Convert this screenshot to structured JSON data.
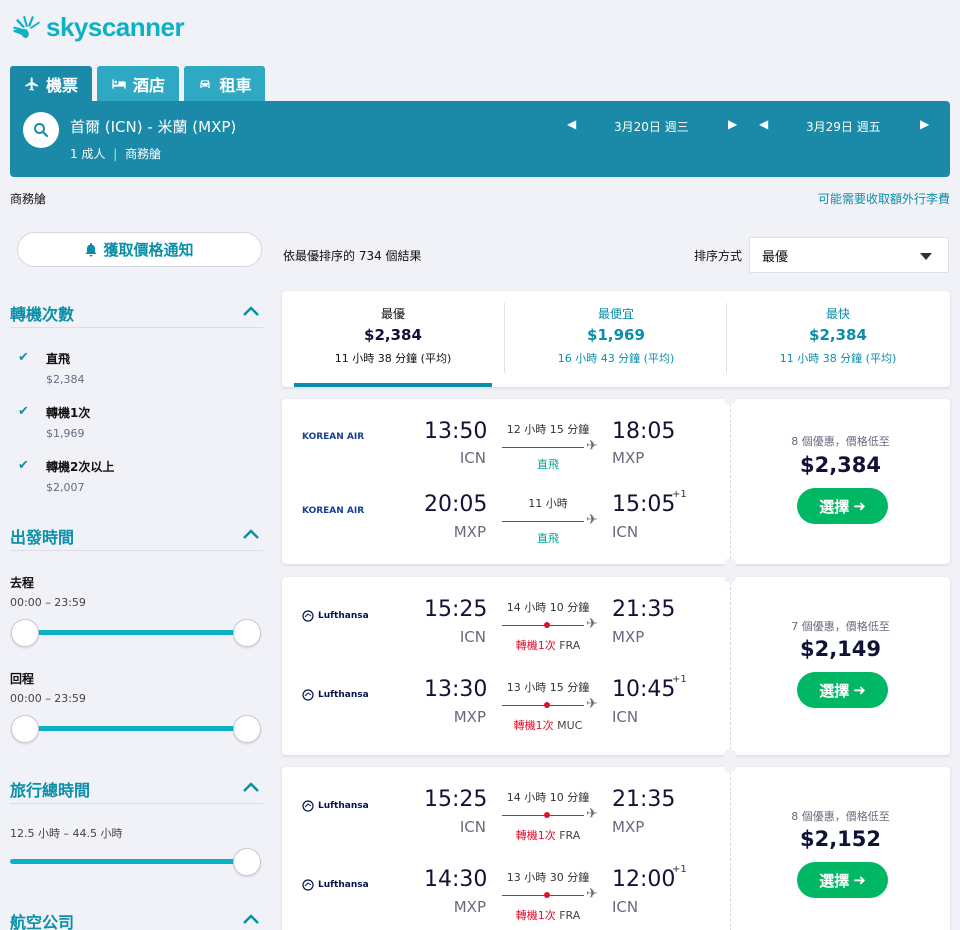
{
  "brand": {
    "name": "skyscanner",
    "color": "#0cb1c6"
  },
  "tabs": [
    {
      "label": "機票",
      "icon": "plane-icon",
      "active": true
    },
    {
      "label": "酒店",
      "icon": "bed-icon",
      "active": false
    },
    {
      "label": "租車",
      "icon": "car-icon",
      "active": false
    }
  ],
  "search": {
    "route": "首爾 (ICN) - 米蘭 (MXP)",
    "passengers": "1 成人",
    "cabin": "商務艙",
    "depart_date": "3月20日 週三",
    "return_date": "3月29日 週五"
  },
  "info_bar": {
    "cabin": "商務艙",
    "bag_notice": "可能需要收取額外行李費"
  },
  "sidebar": {
    "price_alert": "獲取價格通知",
    "stops": {
      "title": "轉機次數",
      "options": [
        {
          "label": "直飛",
          "price": "$2,384",
          "checked": true
        },
        {
          "label": "轉機1次",
          "price": "$1,969",
          "checked": true
        },
        {
          "label": "轉機2次以上",
          "price": "$2,007",
          "checked": true
        }
      ]
    },
    "departure_times": {
      "title": "出發時間",
      "outbound_label": "去程",
      "outbound_range": "00:00 – 23:59",
      "return_label": "回程",
      "return_range": "00:00 – 23:59"
    },
    "duration": {
      "title": "旅行總時間",
      "range": "12.5 小時 – 44.5 小時"
    },
    "airlines": {
      "title": "航空公司"
    }
  },
  "results": {
    "count_text": "依最優排序的 734 個結果",
    "sort_label": "排序方式",
    "sort_value": "最優"
  },
  "sort_tabs": [
    {
      "title": "最優",
      "price": "$2,384",
      "duration": "11 小時 38 分鐘 (平均)",
      "active": true
    },
    {
      "title": "最便宜",
      "price": "$1,969",
      "duration": "16 小時 43 分鐘 (平均)",
      "active": false
    },
    {
      "title": "最快",
      "price": "$2,384",
      "duration": "11 小時 38 分鐘 (平均)",
      "active": false
    }
  ],
  "flights": [
    {
      "legs": [
        {
          "airline": "KOREAN AIR",
          "dep_time": "13:50",
          "dep_code": "ICN",
          "duration": "12 小時 15 分鐘",
          "arr_time": "18:05",
          "arr_code": "MXP",
          "stops": "直飛",
          "via": "",
          "plus": ""
        },
        {
          "airline": "KOREAN AIR",
          "dep_time": "20:05",
          "dep_code": "MXP",
          "duration": "11 小時",
          "arr_time": "15:05",
          "arr_code": "ICN",
          "stops": "直飛",
          "via": "",
          "plus": "+1"
        }
      ],
      "offers": "8 個優惠，價格低至",
      "price": "$2,384",
      "select_label": "選擇"
    },
    {
      "legs": [
        {
          "airline": "Lufthansa",
          "dep_time": "15:25",
          "dep_code": "ICN",
          "duration": "14 小時 10 分鐘",
          "arr_time": "21:35",
          "arr_code": "MXP",
          "stops": "轉機1次",
          "via": "FRA",
          "plus": ""
        },
        {
          "airline": "Lufthansa",
          "dep_time": "13:30",
          "dep_code": "MXP",
          "duration": "13 小時 15 分鐘",
          "arr_time": "10:45",
          "arr_code": "ICN",
          "stops": "轉機1次",
          "via": "MUC",
          "plus": "+1"
        }
      ],
      "offers": "7 個優惠，價格低至",
      "price": "$2,149",
      "select_label": "選擇"
    },
    {
      "legs": [
        {
          "airline": "Lufthansa",
          "dep_time": "15:25",
          "dep_code": "ICN",
          "duration": "14 小時 10 分鐘",
          "arr_time": "21:35",
          "arr_code": "MXP",
          "stops": "轉機1次",
          "via": "FRA",
          "plus": ""
        },
        {
          "airline": "Lufthansa",
          "dep_time": "14:30",
          "dep_code": "MXP",
          "duration": "13 小時 30 分鐘",
          "arr_time": "12:00",
          "arr_code": "ICN",
          "stops": "轉機1次",
          "via": "FRA",
          "plus": "+1"
        }
      ],
      "offers": "8 個優惠，價格低至",
      "price": "$2,152",
      "select_label": "選擇"
    }
  ]
}
